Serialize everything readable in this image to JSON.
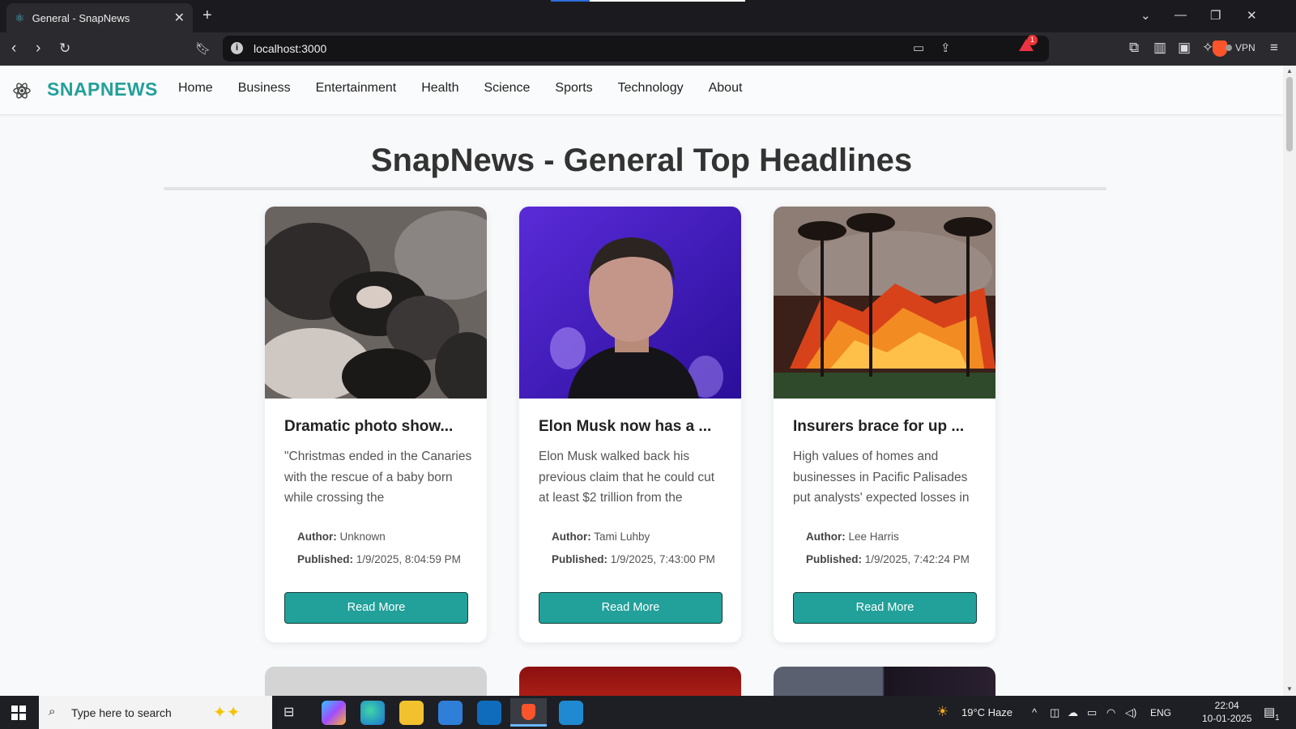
{
  "browser": {
    "tab_title": "General - SnapNews",
    "url": "localhost:3000",
    "vpn_label": "VPN",
    "alert_badge": "1"
  },
  "site": {
    "brand": "SNAPNEWS",
    "nav": [
      "Home",
      "Business",
      "Entertainment",
      "Health",
      "Science",
      "Sports",
      "Technology",
      "About"
    ],
    "heading": "SnapNews - General Top Headlines",
    "accent_color": "#24a09a"
  },
  "articles": [
    {
      "title": "Dramatic photo show...",
      "description": "\"Christmas ended in the Canaries with the rescue of a baby born while crossing the",
      "author_label": "Author:",
      "author": "Unknown",
      "published_label": "Published:",
      "published": "1/9/2025, 8:04:59 PM",
      "button": "Read More"
    },
    {
      "title": "Elon Musk now has a ...",
      "description": "Elon Musk walked back his previous claim that he could cut at least $2 trillion from the",
      "author_label": "Author:",
      "author": "Tami Luhby",
      "published_label": "Published:",
      "published": "1/9/2025, 7:43:00 PM",
      "button": "Read More"
    },
    {
      "title": "Insurers brace for up ...",
      "description": "High values of homes and businesses in Pacific Palisades put analysts' expected losses in",
      "author_label": "Author:",
      "author": "Lee Harris",
      "published_label": "Published:",
      "published": "1/9/2025, 7:42:24 PM",
      "button": "Read More"
    }
  ],
  "taskbar": {
    "search_placeholder": "Type here to search",
    "weather": "19°C  Haze",
    "language": "ENG",
    "time": "22:04",
    "date": "10-01-2025",
    "notification_count": "1"
  }
}
